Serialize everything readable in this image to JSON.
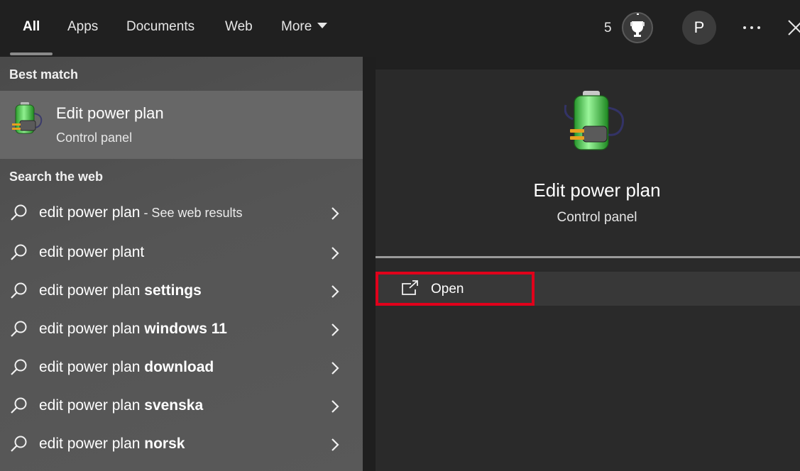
{
  "tabs": [
    {
      "label": "All"
    },
    {
      "label": "Apps"
    },
    {
      "label": "Documents"
    },
    {
      "label": "Web"
    },
    {
      "label": "More"
    }
  ],
  "header": {
    "points": "5",
    "avatar_initial": "P"
  },
  "best_match": {
    "heading": "Best match",
    "title": "Edit power plan",
    "subtitle": "Control panel"
  },
  "web": {
    "heading": "Search the web",
    "items": [
      {
        "base": "edit power plan",
        "bold": "",
        "suffix": " - See web results"
      },
      {
        "base": "edit power plant",
        "bold": "",
        "suffix": ""
      },
      {
        "base": "edit power plan ",
        "bold": "settings",
        "suffix": ""
      },
      {
        "base": "edit power plan ",
        "bold": "windows 11",
        "suffix": ""
      },
      {
        "base": "edit power plan ",
        "bold": "download",
        "suffix": ""
      },
      {
        "base": "edit power plan ",
        "bold": "svenska",
        "suffix": ""
      },
      {
        "base": "edit power plan ",
        "bold": "norsk",
        "suffix": ""
      }
    ]
  },
  "detail": {
    "title": "Edit power plan",
    "subtitle": "Control panel",
    "actions": [
      {
        "label": "Open",
        "icon": "open-external-icon"
      }
    ]
  },
  "icons": {
    "app": "battery-plug-icon",
    "search": "search-icon",
    "chevron": "chevron-right-icon",
    "more": "more-dots-icon",
    "close": "close-icon",
    "rewards": "rewards-trophy-icon"
  },
  "colors": {
    "highlight_border": "#e0001b",
    "battery_green": "#3cc43c"
  }
}
